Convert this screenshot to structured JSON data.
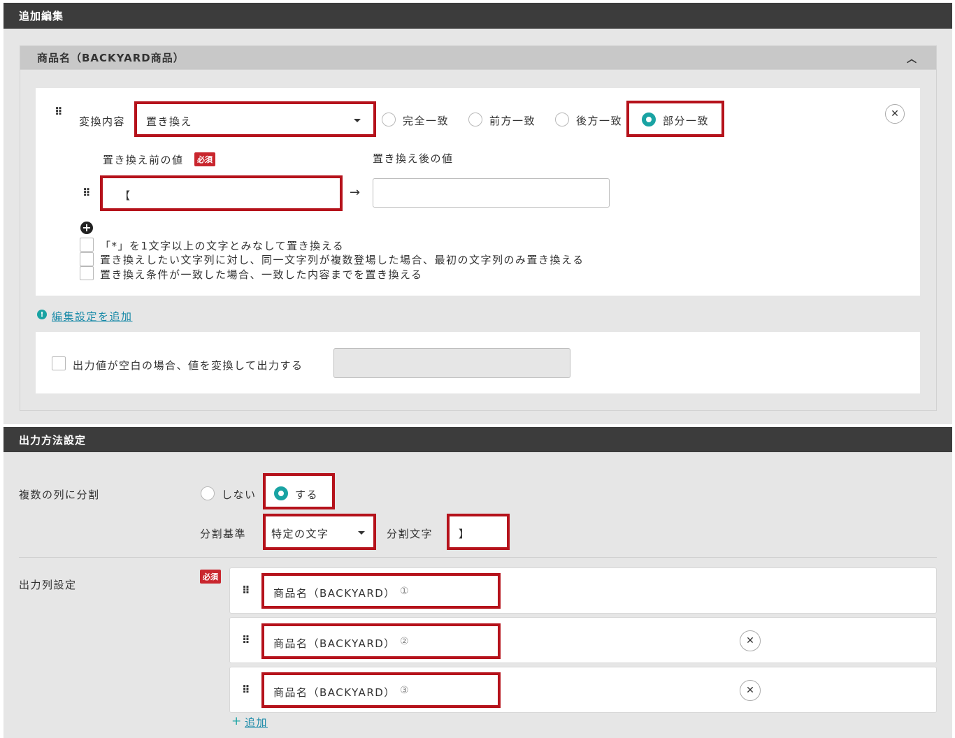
{
  "sections": {
    "additional_edit": "追加編集",
    "output_method": "出力方法設定"
  },
  "panel": {
    "title": "商品名（BACKYARD商品）"
  },
  "conversion": {
    "label": "変換内容",
    "select_value": "置き換え",
    "match_options": [
      "完全一致",
      "前方一致",
      "後方一致",
      "部分一致"
    ],
    "selected_match": "部分一致",
    "before_label": "置き換え前の値",
    "required": "必須",
    "after_label": "置き換え後の値",
    "before_value": "【",
    "after_value": "",
    "checkboxes": [
      "「*」を1文字以上の文字とみなして置き換える",
      "置き換えしたい文字列に対し、同一文字列が複数登場した場合、最初の文字列のみ置き換える",
      "置き換え条件が一致した場合、一致した内容までを置き換える"
    ]
  },
  "add_edit_link": "編集設定を追加",
  "empty_output": {
    "label": "出力値が空白の場合、値を変換して出力する",
    "value": ""
  },
  "split": {
    "label": "複数の列に分割",
    "options": [
      "しない",
      "する"
    ],
    "selected": "する",
    "basis_label": "分割基準",
    "basis_value": "特定の文字",
    "char_label": "分割文字",
    "char_value": "】"
  },
  "output_columns": {
    "label": "出力列設定",
    "required": "必須",
    "columns": [
      {
        "name": "商品名（BACKYARD）",
        "index": "①"
      },
      {
        "name": "商品名（BACKYARD）",
        "index": "②"
      },
      {
        "name": "商品名（BACKYARD）",
        "index": "③"
      }
    ],
    "add_label": "追加"
  },
  "colors": {
    "accent": "#19a3a3",
    "highlight": "#b5121b",
    "header_bar": "#3c3c3c",
    "required": "#c9262e"
  }
}
